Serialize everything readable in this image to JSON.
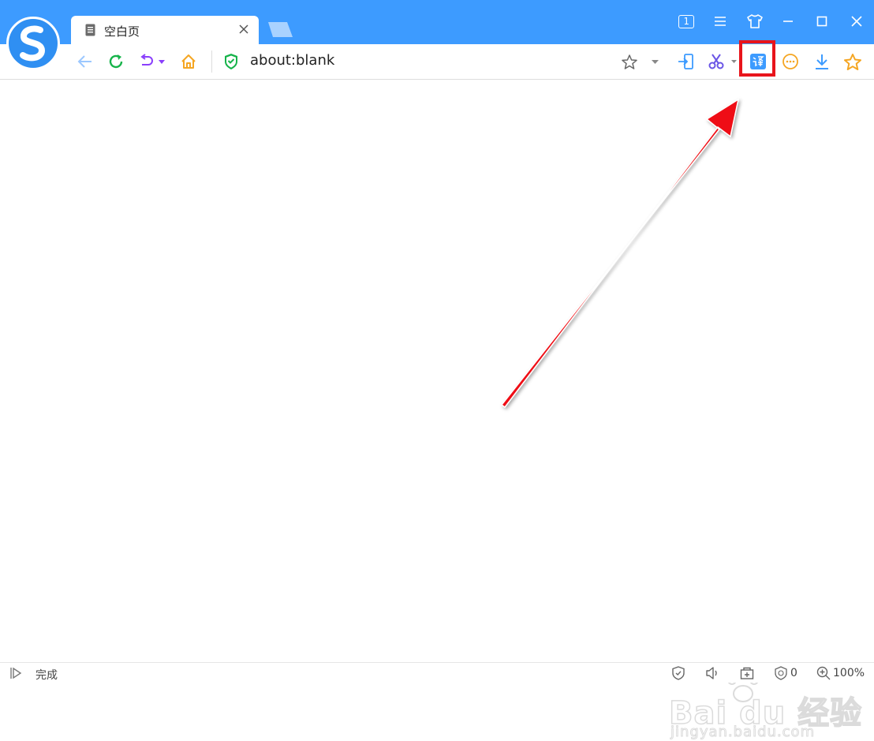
{
  "tab": {
    "title": "空白页"
  },
  "window": {
    "tab_count": "1"
  },
  "address": {
    "url": "about:blank"
  },
  "status": {
    "text": "完成",
    "ad_block_count": "0",
    "zoom": "100%"
  },
  "watermark": {
    "main": "Bai du 经验",
    "sub": "jingyan.baidu.com"
  },
  "colors": {
    "titlebar": "#3d9bff",
    "highlight": "#e8141b",
    "accent_green": "#16b34a",
    "accent_orange": "#f5a623",
    "accent_purple": "#8a3ffc",
    "icon_blue": "#3d9bff"
  }
}
